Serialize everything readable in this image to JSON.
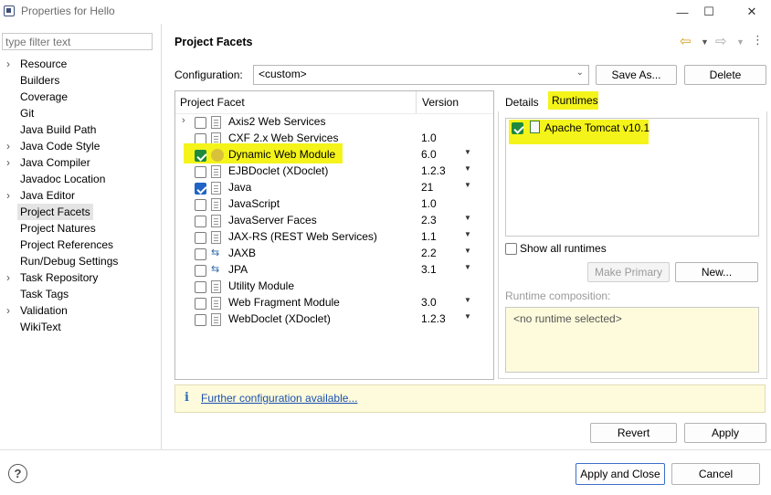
{
  "window": {
    "title": "Properties for Hello"
  },
  "filter": {
    "placeholder": "type filter text"
  },
  "nav": {
    "items": [
      {
        "label": "Resource",
        "expandable": true
      },
      {
        "label": "Builders",
        "expandable": false
      },
      {
        "label": "Coverage",
        "expandable": false
      },
      {
        "label": "Git",
        "expandable": false
      },
      {
        "label": "Java Build Path",
        "expandable": false
      },
      {
        "label": "Java Code Style",
        "expandable": true
      },
      {
        "label": "Java Compiler",
        "expandable": true
      },
      {
        "label": "Javadoc Location",
        "expandable": false
      },
      {
        "label": "Java Editor",
        "expandable": true
      },
      {
        "label": "Project Facets",
        "expandable": false,
        "selected": true
      },
      {
        "label": "Project Natures",
        "expandable": false
      },
      {
        "label": "Project References",
        "expandable": false
      },
      {
        "label": "Run/Debug Settings",
        "expandable": false
      },
      {
        "label": "Task Repository",
        "expandable": true
      },
      {
        "label": "Task Tags",
        "expandable": false
      },
      {
        "label": "Validation",
        "expandable": true
      },
      {
        "label": "WikiText",
        "expandable": false
      }
    ]
  },
  "page": {
    "title": "Project Facets"
  },
  "config": {
    "label": "Configuration:",
    "value": "<custom>",
    "save_as": "Save As...",
    "delete": "Delete"
  },
  "table": {
    "col_facet": "Project Facet",
    "col_version": "Version",
    "rows": [
      {
        "name": "Axis2 Web Services",
        "version": "",
        "checked": false,
        "expandable": true,
        "dropdown": false,
        "icon": "file-icon"
      },
      {
        "name": "CXF 2.x Web Services",
        "version": "1.0",
        "checked": false,
        "expandable": false,
        "dropdown": false,
        "icon": "file-icon"
      },
      {
        "name": "Dynamic Web Module",
        "version": "6.0",
        "checked": true,
        "expandable": false,
        "dropdown": true,
        "icon": "web-module-icon",
        "highlighted": true
      },
      {
        "name": "EJBDoclet (XDoclet)",
        "version": "1.2.3",
        "checked": false,
        "expandable": false,
        "dropdown": true,
        "icon": "file-icon"
      },
      {
        "name": "Java",
        "version": "21",
        "checked": true,
        "expandable": false,
        "dropdown": true,
        "icon": "java-icon"
      },
      {
        "name": "JavaScript",
        "version": "1.0",
        "checked": false,
        "expandable": false,
        "dropdown": false,
        "icon": "file-icon"
      },
      {
        "name": "JavaServer Faces",
        "version": "2.3",
        "checked": false,
        "expandable": false,
        "dropdown": true,
        "icon": "file-icon"
      },
      {
        "name": "JAX-RS (REST Web Services)",
        "version": "1.1",
        "checked": false,
        "expandable": false,
        "dropdown": true,
        "icon": "file-icon"
      },
      {
        "name": "JAXB",
        "version": "2.2",
        "checked": false,
        "expandable": false,
        "dropdown": true,
        "icon": "arrows-icon"
      },
      {
        "name": "JPA",
        "version": "3.1",
        "checked": false,
        "expandable": false,
        "dropdown": true,
        "icon": "arrows-icon"
      },
      {
        "name": "Utility Module",
        "version": "",
        "checked": false,
        "expandable": false,
        "dropdown": false,
        "icon": "file-icon"
      },
      {
        "name": "Web Fragment Module",
        "version": "3.0",
        "checked": false,
        "expandable": false,
        "dropdown": true,
        "icon": "file-icon"
      },
      {
        "name": "WebDoclet (XDoclet)",
        "version": "1.2.3",
        "checked": false,
        "expandable": false,
        "dropdown": true,
        "icon": "file-icon"
      }
    ]
  },
  "tabs": {
    "details": "Details",
    "runtimes": "Runtimes"
  },
  "runtimes": {
    "items": [
      {
        "label": "Apache Tomcat v10.1",
        "checked": true
      }
    ],
    "show_all": "Show all runtimes",
    "make_primary": "Make Primary",
    "new": "New...",
    "composition_label": "Runtime composition:",
    "composition_value": "<no runtime selected>"
  },
  "info": {
    "icon": "i",
    "link": "Further configuration available..."
  },
  "buttons": {
    "revert": "Revert",
    "apply": "Apply",
    "apply_close": "Apply and Close",
    "cancel": "Cancel"
  },
  "help": {
    "glyph": "?"
  },
  "colors": {
    "highlight": "#f4f41a",
    "checkbox": "#1f64c6",
    "info_bg": "#fefbdc",
    "link": "#1a50b0"
  }
}
